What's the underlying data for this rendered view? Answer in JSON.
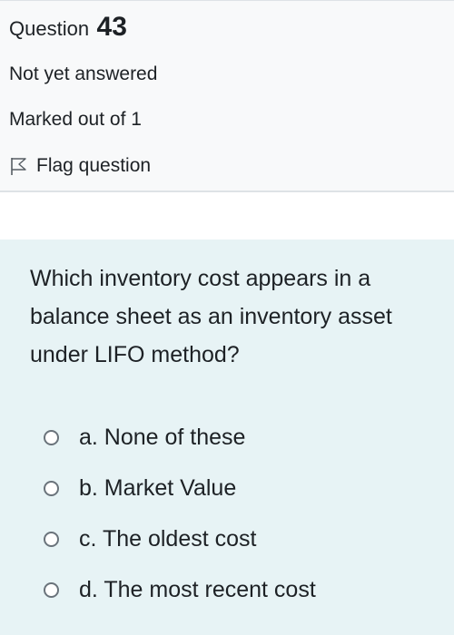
{
  "question_info": {
    "label": "Question",
    "number": "43",
    "state": "Not yet answered",
    "grade": "Marked out of 1",
    "flag_label": "Flag question",
    "flag_icon": "flag-outline-icon"
  },
  "question": {
    "text": "Which inventory cost appears in a balance sheet as an inventory asset under LIFO method?",
    "options": [
      {
        "label": "a. None of these",
        "selected": false
      },
      {
        "label": "b. Market Value",
        "selected": false
      },
      {
        "label": "c. The oldest cost",
        "selected": false
      },
      {
        "label": "d. The most recent cost",
        "selected": false
      }
    ]
  },
  "colors": {
    "info_background": "#f8f9fa",
    "content_background": "#e7f3f5",
    "text": "#1d2125",
    "radio_border": "#6a737b"
  }
}
